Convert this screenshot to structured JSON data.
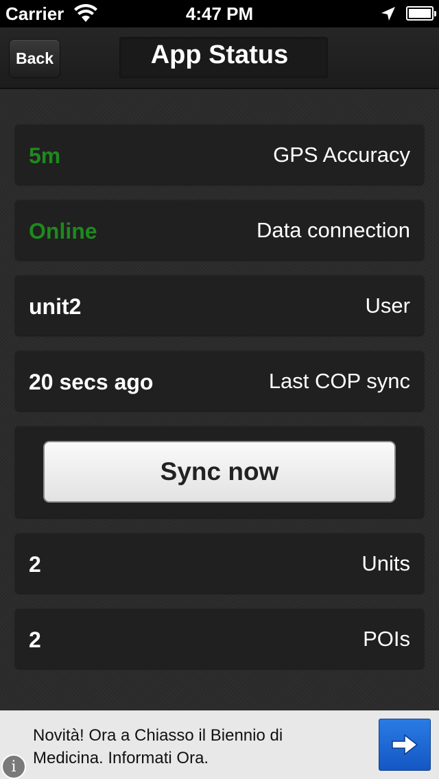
{
  "status_bar": {
    "carrier": "Carrier",
    "time": "4:47 PM",
    "icons": [
      "wifi-icon",
      "location-arrow-icon",
      "battery-icon"
    ]
  },
  "nav": {
    "back_label": "Back",
    "title": "App Status"
  },
  "rows": [
    {
      "value": "5m",
      "label": "GPS Accuracy",
      "value_color": "#1d8a1d"
    },
    {
      "value": "Online",
      "label": "Data connection",
      "value_color": "#1d8a1d"
    },
    {
      "value": "unit2",
      "label": "User"
    },
    {
      "value": "20 secs ago",
      "label": "Last COP sync"
    }
  ],
  "sync_button_label": "Sync now",
  "counts": [
    {
      "value": "2",
      "label": "Units"
    },
    {
      "value": "2",
      "label": "POIs"
    }
  ],
  "ad": {
    "line1": "Novità! Ora a Chiasso il Biennio di",
    "line2": "Medicina. Informati Ora.",
    "info_glyph": "i",
    "button_color": "#1a66d6"
  }
}
